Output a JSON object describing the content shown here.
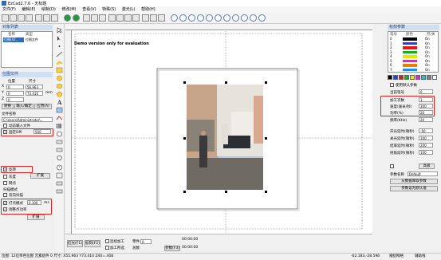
{
  "window": {
    "title": "EzCad2.7.6 - 无标题"
  },
  "menu": {
    "items": [
      "文件(F)",
      "编辑(E)",
      "绘制(D)",
      "修改(M)",
      "查看(V)",
      "特殊(S)",
      "激光(L)",
      "帮助(H)"
    ]
  },
  "object_list": {
    "header": "对象列表",
    "columns": [
      "名称",
      "类型"
    ],
    "rows": [
      {
        "name": "位图(42...",
        "type": "位图文件"
      }
    ]
  },
  "object_props": {
    "header": "位图文件",
    "pos_label": "位置",
    "size_label": "尺寸",
    "x_label": "X",
    "y_label": "Y",
    "z_label": "Z",
    "x_pos": "0",
    "y_pos": "0",
    "z_pos": "0",
    "width": "56.963",
    "height": "73.410",
    "unit": "mm",
    "btn_replace": "转换",
    "btn_input": "输入/确定",
    "btn_apply": "应用(A)",
    "file_name_label": "文件名称",
    "file_path": "C:\\Users\\Administrator\\...",
    "check_dynamic": "动态输入文件",
    "check_fixed_dpi": "固定DPI",
    "dpi_value": "500",
    "check_invert": "反转",
    "check_gray": "灰度",
    "check_grid": "网点",
    "btn_more": "扩展",
    "scan_mode_label": "扫描模式",
    "check_bidir": "双向扫描",
    "check_dot_mode": "打点模式",
    "dot_time": "0.100",
    "dot_unit": "ms",
    "check_power_adjust": "调整点功率",
    "btn_expand": "扩展"
  },
  "canvas": {
    "demo_text": "Demo version only for evaluation"
  },
  "pens": {
    "header": "标刻参数",
    "columns": [
      "笔号",
      "颜色",
      "开/关"
    ],
    "rows": [
      {
        "no": "0",
        "color": "#000000",
        "state": "On"
      },
      {
        "no": "1",
        "color": "#1f3ff0",
        "state": "On"
      },
      {
        "no": "2",
        "color": "#e01818",
        "state": "On"
      },
      {
        "no": "3",
        "color": "#18b018",
        "state": "On"
      },
      {
        "no": "4",
        "color": "#e6e600",
        "state": "On"
      },
      {
        "no": "5",
        "color": "#e61ee6",
        "state": "On"
      },
      {
        "no": "6",
        "color": "#e67e00",
        "state": "On"
      },
      {
        "no": "7",
        "color": "#1f8ef0",
        "state": "On"
      }
    ]
  },
  "params": {
    "palette": [
      "#000000",
      "#1f3ff0",
      "#e01818",
      "#18b018",
      "#e6e600",
      "#e61ee6",
      "#18c8c8",
      "#808080",
      "#ffffff"
    ],
    "use_default_label": "使用默认参数",
    "current_pen_label": "当前笔号",
    "current_pen_value": "0",
    "process_count_label": "加工次数",
    "process_count_value": "1",
    "speed_label": "速度(毫米/秒)",
    "speed_value": "300",
    "power_label": "功率(%)",
    "power_value": "20",
    "freq_label": "频率(KHz)",
    "freq_value": "20",
    "on_delay_label": "开光延时(微秒)",
    "on_delay_value": "-50",
    "off_delay_label": "关光延时(微秒)",
    "off_delay_value": "100",
    "end_delay_label": "结束延时(微秒)",
    "end_delay_value": "200",
    "corner_delay_label": "拐角延时(微秒)",
    "corner_delay_value": "100",
    "advanced_label": "高级",
    "param_name_label": "参数名称",
    "param_name_value": "Default",
    "btn_load": "从数据库取参数",
    "btn_save_default": "参数设为默认值"
  },
  "bottom": {
    "btn_red": "红光(F1)",
    "btn_mark": "标刻(F2)",
    "chk_continuous": "连续加工",
    "chk_selected": "加工所选",
    "part_label": "零件",
    "total_label": "总数",
    "part_value": "0",
    "time1": "00:00:00",
    "time2": "00:00:00",
    "param_btn": "参数(F3)"
  },
  "status": {
    "text": "位图: 12位单色位图 元素组件 0 尺寸: X55.963 Y73.410 Z40=.408",
    "coords": "-62.183,-28.596",
    "snap": "捕捉网格",
    "guides": "辅助线"
  }
}
